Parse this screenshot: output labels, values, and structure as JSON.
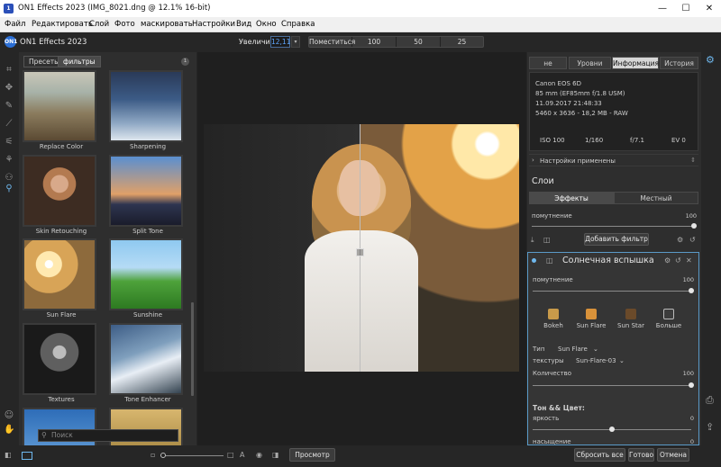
{
  "window": {
    "title": "ON1 Effects 2023 (IMG_8021.dng @ 12.1% 16-bit)",
    "minimize": "—",
    "maximize": "☐",
    "close": "✕"
  },
  "menu": [
    "Файл",
    "Редактировать",
    "Слой",
    "Фото",
    "маскировать",
    "Настройки",
    "Вид",
    "Окно",
    "Справка"
  ],
  "toolbar": {
    "brand": "ON1 Effects 2023",
    "zoom_label": "Увеличить",
    "zoom_value": "12,11",
    "zoom_options": [
      "Поместиться",
      "100",
      "50",
      "25"
    ]
  },
  "presets": {
    "tabs": [
      "Пресеты",
      "фильтры"
    ],
    "active_tab": "фильтры",
    "badge": "1",
    "search_placeholder": "Поиск",
    "items": [
      {
        "label": "Replace Color"
      },
      {
        "label": "Sharpening"
      },
      {
        "label": "Skin Retouching"
      },
      {
        "label": "Split Tone"
      },
      {
        "label": "Sun Flare"
      },
      {
        "label": "Sunshine"
      },
      {
        "label": "Textures"
      },
      {
        "label": "Tone Enhancer"
      }
    ]
  },
  "right": {
    "tabs": [
      "не",
      "Уровни",
      "Информация",
      "История"
    ],
    "active_tab": "Информация",
    "camera": "Canon EOS 6D",
    "lens": "85 mm (EF85mm f/1.8 USM)",
    "datetime": "11.09.2017 21:48:33",
    "dims": "5460 x 3636 - 18,2 MB - RAW",
    "iso": "ISO 100",
    "shutter": "1/160",
    "aperture": "f/7.1",
    "ev": "EV 0",
    "applied_settings": "Настройки применены",
    "layers_title": "Слои",
    "layer_tabs": [
      "Эффекты",
      "Местный"
    ],
    "opacity_label": "помутнение",
    "opacity_value": "100",
    "opacity": 1.0,
    "add_filter": "Добавить фильтр",
    "filter": {
      "title": "Солнечная вспышка",
      "opacity_label": "помутнение",
      "opacity_value": "100",
      "opacity": 1.0,
      "types": [
        {
          "name": "Bokeh",
          "color": "#c89a4a"
        },
        {
          "name": "Sun Flare",
          "color": "#d9923a"
        },
        {
          "name": "Sun Star",
          "color": "#6a4a2a"
        },
        {
          "name": "Больше",
          "color": "#3c3c3c"
        }
      ],
      "type_label": "Тип",
      "type_value": "Sun Flare",
      "texture_label": "текстуры",
      "texture_value": "Sun-Flare-03",
      "amount_label": "Количество",
      "amount_value": "100",
      "amount": 1.0,
      "tone_title": "Тон && Цвет:",
      "brightness_label": "яркость",
      "brightness_value": "0",
      "brightness": 0.5,
      "saturation_label": "насыщение",
      "saturation_value": "0"
    }
  },
  "bottom": {
    "preview": "Просмотр",
    "reset_all": "Сбросить все",
    "done": "Готово",
    "cancel": "Отмена"
  },
  "colors": {
    "accent": "#5fa6ff",
    "panel": "#2e2e2e",
    "card_border": "#5a9ac8"
  }
}
